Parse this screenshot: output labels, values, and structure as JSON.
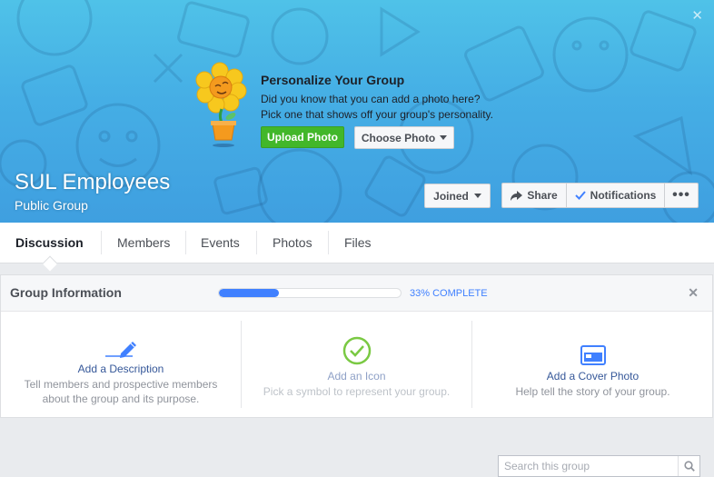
{
  "cover": {
    "prompt_title": "Personalize Your Group",
    "prompt_line1": "Did you know that you can add a photo here?",
    "prompt_line2": "Pick one that shows off your group's personality.",
    "upload_label": "Upload Photo",
    "choose_label": "Choose Photo",
    "close_label": "✕"
  },
  "group": {
    "name": "SUL Employees",
    "type": "Public Group"
  },
  "actions": {
    "joined_label": "Joined",
    "share_label": "Share",
    "notifications_label": "Notifications",
    "more_label": "•••"
  },
  "tabs": [
    {
      "label": "Discussion",
      "active": true
    },
    {
      "label": "Members"
    },
    {
      "label": "Events"
    },
    {
      "label": "Photos"
    },
    {
      "label": "Files"
    }
  ],
  "search": {
    "placeholder": "Search this group"
  },
  "info": {
    "title": "Group Information",
    "progress_fraction": 0.33,
    "progress_text": "33% COMPLETE",
    "close_label": "✕",
    "tasks": [
      {
        "title": "Add a Description",
        "desc_line1": "Tell members and prospective members",
        "desc_line2": "about the group and its purpose.",
        "icon": "pencil-icon"
      },
      {
        "title": "Add an Icon",
        "desc_line1": "Pick a symbol to represent your group.",
        "icon": "checkmark-circle-icon",
        "disabled": true
      },
      {
        "title": "Add a Cover Photo",
        "desc_line1": "Help tell the story of your group.",
        "icon": "photo-card-icon"
      }
    ]
  },
  "colors": {
    "accent": "#4080ff",
    "link": "#365899",
    "upload_green": "#42b72a",
    "cover_blue": "#45aee5"
  }
}
